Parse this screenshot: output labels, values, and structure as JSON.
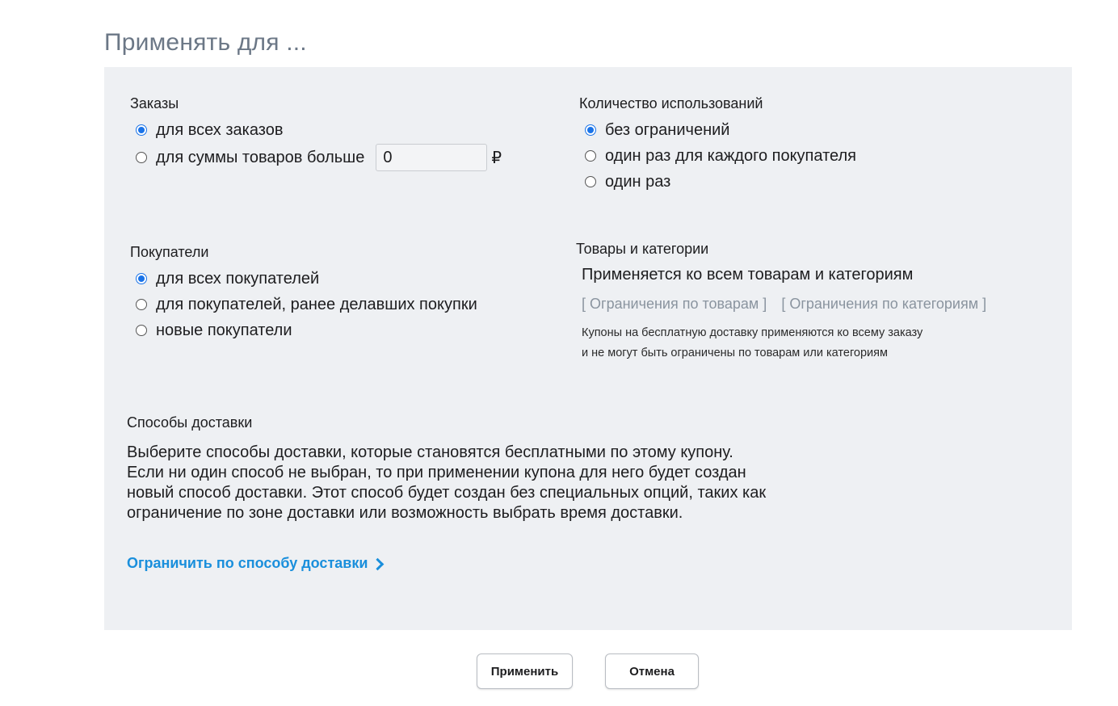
{
  "page": {
    "title": "Применять для ..."
  },
  "orders": {
    "title": "Заказы",
    "options": [
      {
        "label": "для всех заказов",
        "checked": true
      },
      {
        "label": "для суммы товаров больше",
        "checked": false
      }
    ],
    "amount_value": "0",
    "currency": "₽"
  },
  "usage": {
    "title": "Количество использований",
    "options": [
      {
        "label": "без ограничений",
        "checked": true
      },
      {
        "label": "один раз для каждого покупателя",
        "checked": false
      },
      {
        "label": "один раз",
        "checked": false
      }
    ]
  },
  "customers": {
    "title": "Покупатели",
    "options": [
      {
        "label": "для всех покупателей",
        "checked": true
      },
      {
        "label": "для покупателей, ранее делавших покупки",
        "checked": false
      },
      {
        "label": "новые покупатели",
        "checked": false
      }
    ]
  },
  "products": {
    "title": "Товары и категории",
    "applies_text": "Применяется ко всем товарам и категориям",
    "restrict_products_link": "[ Ограничения по товарам ]",
    "restrict_categories_link": "[ Ограничения по категориям ]",
    "note_line1": "Купоны на бесплатную доставку применяются ко всему заказу",
    "note_line2": "и не могут быть ограничены по товарам или категориям"
  },
  "delivery": {
    "title": "Способы доставки",
    "description": "Выберите способы доставки, которые становятся бесплатными по этому купону. Если ни один способ не выбран, то при применении купона для него будет создан новый способ доставки. Этот способ будет создан без специальных опций, таких как ограничение по зоне доставки или возможность выбрать время доставки.",
    "link_label": "Ограничить по способу доставки"
  },
  "buttons": {
    "apply": "Применить",
    "cancel": "Отмена"
  },
  "colors": {
    "accent": "#1a73e8",
    "link": "#1a8fdc",
    "panel_bg": "#eef0f3"
  }
}
